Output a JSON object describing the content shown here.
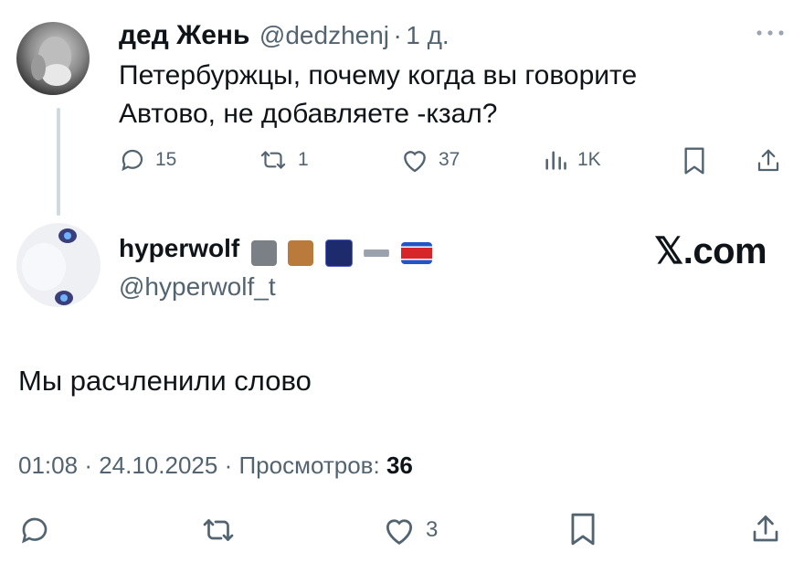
{
  "tweet1": {
    "name": "дед Жень",
    "handle": "@dedzhenj",
    "sep": "·",
    "time": "1 д.",
    "text_line1": "Петербуржцы, почему когда вы говорите",
    "text_line2": "Автово, не добавляете -кзал?",
    "replies": "15",
    "reposts": "1",
    "likes": "37",
    "views": "1K"
  },
  "tweet2": {
    "name": "hyperwolf",
    "handle": "@hyperwolf_t",
    "emojis": [
      "wolf-emoji",
      "horse-emoji",
      "night-sky-emoji",
      "ufo-emoji",
      "north-korea-flag-emoji"
    ],
    "text": "Мы расчленили слово",
    "time": "01:08",
    "date": "24.10.2025",
    "views_label": "Просмотров:",
    "views_count": "36",
    "likes": "3"
  },
  "watermark": "𝕏.com",
  "colors": {
    "text": "#0f1419",
    "secondary": "#536471",
    "thread": "#cfd9de"
  }
}
